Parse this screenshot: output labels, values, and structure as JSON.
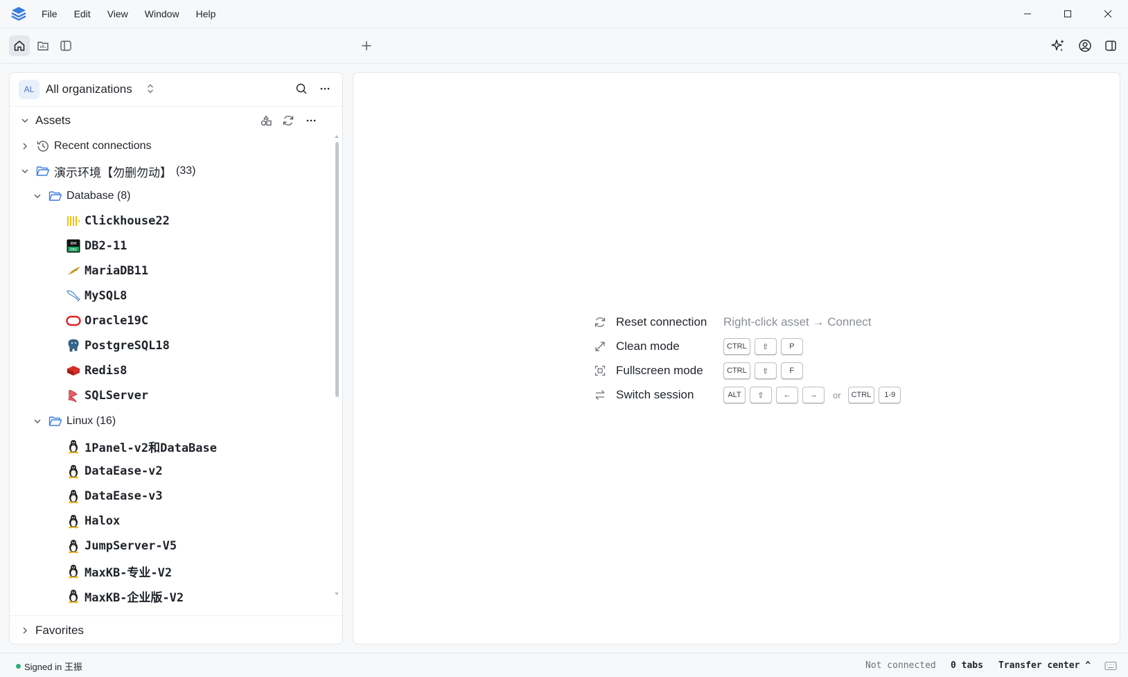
{
  "menu": {
    "items": [
      "File",
      "Edit",
      "View",
      "Window",
      "Help"
    ]
  },
  "sidebar": {
    "org": {
      "avatar": "AL",
      "name": "All organizations"
    },
    "assets_label": "Assets",
    "recent_label": "Recent connections",
    "root_folder": {
      "name": "演示环境【勿删勿动】",
      "count": "(33)"
    },
    "database_folder": "Database (8)",
    "databases": [
      "Clickhouse22",
      "DB2-11",
      "MariaDB11",
      "MySQL8",
      "Oracle19C",
      "PostgreSQL18",
      "Redis8",
      "SQLServer"
    ],
    "linux_folder": "Linux (16)",
    "linux": [
      "1Panel-v2和DataBase",
      "DataEase-v2",
      "DataEase-v3",
      "Halox",
      "JumpServer-V5",
      "MaxKB-专业-V2",
      "MaxKB-企业版-V2"
    ],
    "favorites_label": "Favorites"
  },
  "hints": {
    "reset": {
      "label": "Reset connection",
      "desc": "Right-click asset → Connect"
    },
    "clean": {
      "label": "Clean mode",
      "keys": [
        "CTRL",
        "⇧",
        "P"
      ]
    },
    "fullscreen": {
      "label": "Fullscreen mode",
      "keys": [
        "CTRL",
        "⇧",
        "F"
      ]
    },
    "switch": {
      "label": "Switch session",
      "keys": [
        "ALT",
        "⇧",
        "←",
        "→"
      ],
      "or": "or",
      "alt_keys": [
        "CTRL",
        "1-9"
      ]
    }
  },
  "status": {
    "signed_in": "Signed in 王振",
    "connection": "Not connected",
    "tabs": "0 tabs",
    "transfer": "Transfer center ^"
  },
  "colors": {
    "accent": "#3b7de0",
    "online": "#2db07a",
    "folder": "#3b7de0"
  }
}
